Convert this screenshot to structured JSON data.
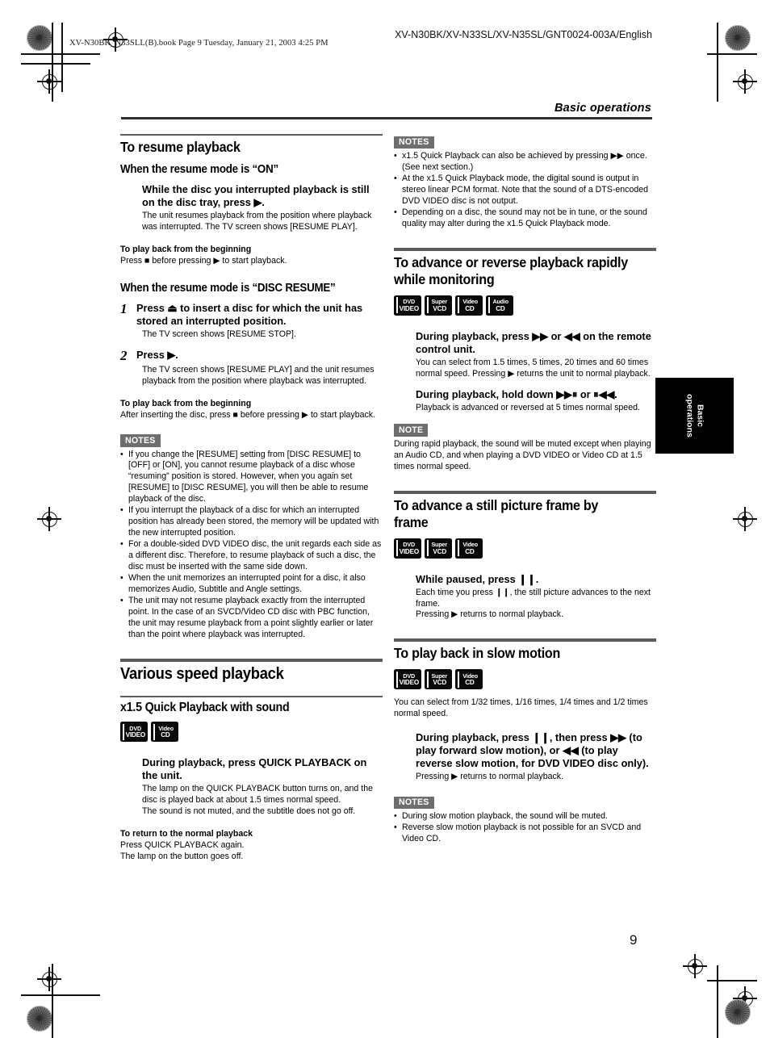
{
  "header": {
    "book_line": "XV-N30BK_N33SLL(B).book  Page 9  Tuesday, January 21, 2003  4:25 PM",
    "product_line": "XV-N30BK/XV-N33SL/XV-N35SL/GNT0024-003A/English",
    "chapter_title": "Basic operations"
  },
  "side_tab": {
    "line1": "Basic",
    "line2": "operations"
  },
  "page_number": "9",
  "badges": {
    "dvd_video": {
      "l1": "DVD",
      "l2": "VIDEO"
    },
    "super_vcd": {
      "l1": "Super",
      "l2": "VCD"
    },
    "video_cd": {
      "l1": "Video",
      "l2": "CD"
    },
    "audio_cd": {
      "l1": "Audio",
      "l2": "CD"
    }
  },
  "labels": {
    "notes": "NOTES",
    "note": "NOTE"
  },
  "left": {
    "s1": {
      "heading": "To resume playback",
      "sub1": "When the resume mode is “ON”",
      "step1_title": "While the disc you interrupted playback is still on the disc tray, press ▶.",
      "step1_body": "The unit resumes playback from the position where playback was interrupted. The TV screen shows [RESUME PLAY].",
      "beginning_head1": "To play back from the beginning",
      "beginning_body1": "Press ■ before pressing ▶ to start playback.",
      "sub2": "When the resume mode is “DISC RESUME”",
      "num1": "1",
      "num1_title": "Press ⏏ to insert a disc for which the unit has stored an interrupted position.",
      "num1_body": "The TV screen shows [RESUME STOP].",
      "num2": "2",
      "num2_title": "Press ▶.",
      "num2_body": "The TV screen shows [RESUME PLAY] and the unit resumes playback from the position where playback was interrupted.",
      "beginning_head2": "To play back from the beginning",
      "beginning_body2": "After inserting the disc, press ■ before pressing ▶ to start playback.",
      "notes": [
        "If you change the [RESUME] setting from [DISC RESUME] to [OFF] or [ON], you cannot resume playback of a disc whose “resuming” position is stored. However, when you again set [RESUME] to [DISC RESUME], you will then be able to resume playback of the disc.",
        "If you interrupt the playback of a disc for which an interrupted position has already been stored, the memory will be updated with the new interrupted position.",
        "For a double-sided DVD VIDEO disc, the unit regards each side as a different disc. Therefore, to resume playback of such a disc, the disc must be inserted with the same side down.",
        "When the unit memorizes an interrupted point for a disc, it also memorizes Audio, Subtitle and Angle settings.",
        "The unit may not resume playback exactly from the interrupted point. In the case of an SVCD/Video CD disc with PBC function, the unit may resume playback from a point slightly earlier or later than the point where playback was interrupted."
      ]
    },
    "s2": {
      "heading": "Various speed playback",
      "sub": "x1.5 Quick Playback with sound",
      "step_title": "During playback, press QUICK PLAYBACK on the unit.",
      "step_body1": "The lamp on the QUICK PLAYBACK button turns on, and the disc is played back at about 1.5 times normal speed.",
      "step_body2": "The sound is not muted, and the subtitle does not go off.",
      "return_head": "To return to the normal playback",
      "return_body1": "Press QUICK PLAYBACK again.",
      "return_body2": "The lamp on the button goes off."
    }
  },
  "right": {
    "notes_top": [
      "x1.5 Quick Playback can also be achieved by pressing ▶▶ once. (See next section.)",
      "At the x1.5 Quick Playback mode, the digital sound is output in stereo linear PCM format. Note that the sound of a DTS-encoded DVD VIDEO disc is not output.",
      "Depending on a disc, the sound may not be in tune, or the sound quality may alter during the x1.5 Quick Playback mode."
    ],
    "s3": {
      "heading": "To advance or reverse playback rapidly while monitoring",
      "step1_title": "During playback, press ▶▶ or ◀◀ on the remote control unit.",
      "step1_body": "You can select from 1.5 times, 5 times, 20 times and 60 times normal speed. Pressing ▶ returns the unit to normal playback.",
      "step2_title": "During playback, hold down ▶▶⏸ or ⏸◀◀.",
      "step2_body": "Playback is advanced or reversed at 5 times normal speed.",
      "note_body": "During rapid playback, the sound will be muted except when playing an Audio CD, and when playing a DVD VIDEO or Video CD at 1.5 times normal speed."
    },
    "s4": {
      "heading": "To advance a still picture frame by frame",
      "step_title": "While paused, press ❙❙.",
      "step_body1": "Each time you press ❙❙, the still picture advances to the next frame.",
      "step_body2": "Pressing ▶ returns to normal playback."
    },
    "s5": {
      "heading": "To play back in slow motion",
      "intro": "You can select from 1/32 times, 1/16 times, 1/4 times and 1/2 times normal speed.",
      "step_title": "During playback, press ❙❙, then press ▶▶ (to play forward slow motion), or ◀◀ (to play reverse slow motion, for DVD VIDEO disc only).",
      "step_body": "Pressing ▶ returns to normal playback.",
      "notes": [
        "During slow motion playback, the sound will be muted.",
        "Reverse slow motion playback is not possible for an SVCD and Video CD."
      ]
    }
  }
}
